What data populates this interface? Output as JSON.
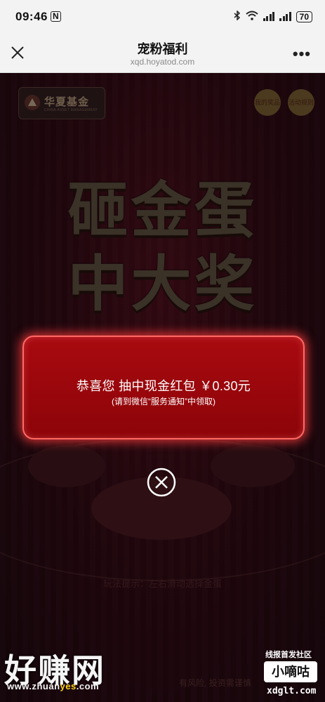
{
  "status_bar": {
    "time": "09:46",
    "nfc": "N",
    "battery": "70"
  },
  "titlebar": {
    "title": "宠粉福利",
    "url": "xqd.hoyatod.com"
  },
  "page": {
    "logo_text": "华夏基金",
    "logo_sub": "CHINA ASSET MANAGEMENT",
    "my_prizes": "我的奖品",
    "rules": "活动规则",
    "headline_line1": "砸金蛋",
    "headline_line2": "中大奖",
    "hint": "玩法提示：左右滑动选择金蛋",
    "footer_risk": "有风险, 投资需谨慎"
  },
  "dialog": {
    "message": "恭喜您 抽中现金红包 ￥0.30元",
    "note": "(请到微信“服务通知”中领取)"
  },
  "watermark": {
    "site_big": "好赚网",
    "site_url_pre": "www.zhuan",
    "site_url_yes": "yes",
    "site_url_post": ".com",
    "badge_top": "线报首发社区",
    "badge": "小嘀咕",
    "badge_url": "xdglt.com"
  },
  "colors": {
    "dialog_bg": "#a80a10",
    "dialog_border": "#ff6a66",
    "page_bg": "#3a0c18"
  }
}
